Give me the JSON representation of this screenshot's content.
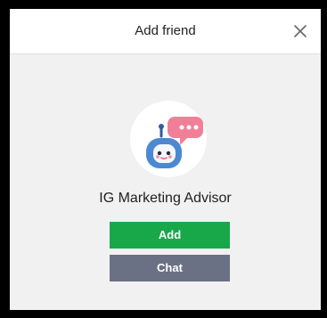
{
  "dialog": {
    "title": "Add friend",
    "close_icon": "close-icon",
    "profile": {
      "name": "IG Marketing Advisor",
      "avatar_icon": "robot-chat-icon"
    },
    "buttons": {
      "add_label": "Add",
      "chat_label": "Chat"
    }
  },
  "colors": {
    "add_button": "#18a84a",
    "chat_button": "#6a7185",
    "dialog_background": "#f1f1f2",
    "header_background": "#ffffff",
    "speech_bubble": "#f27f98",
    "robot_face": "#4b8ad1"
  }
}
